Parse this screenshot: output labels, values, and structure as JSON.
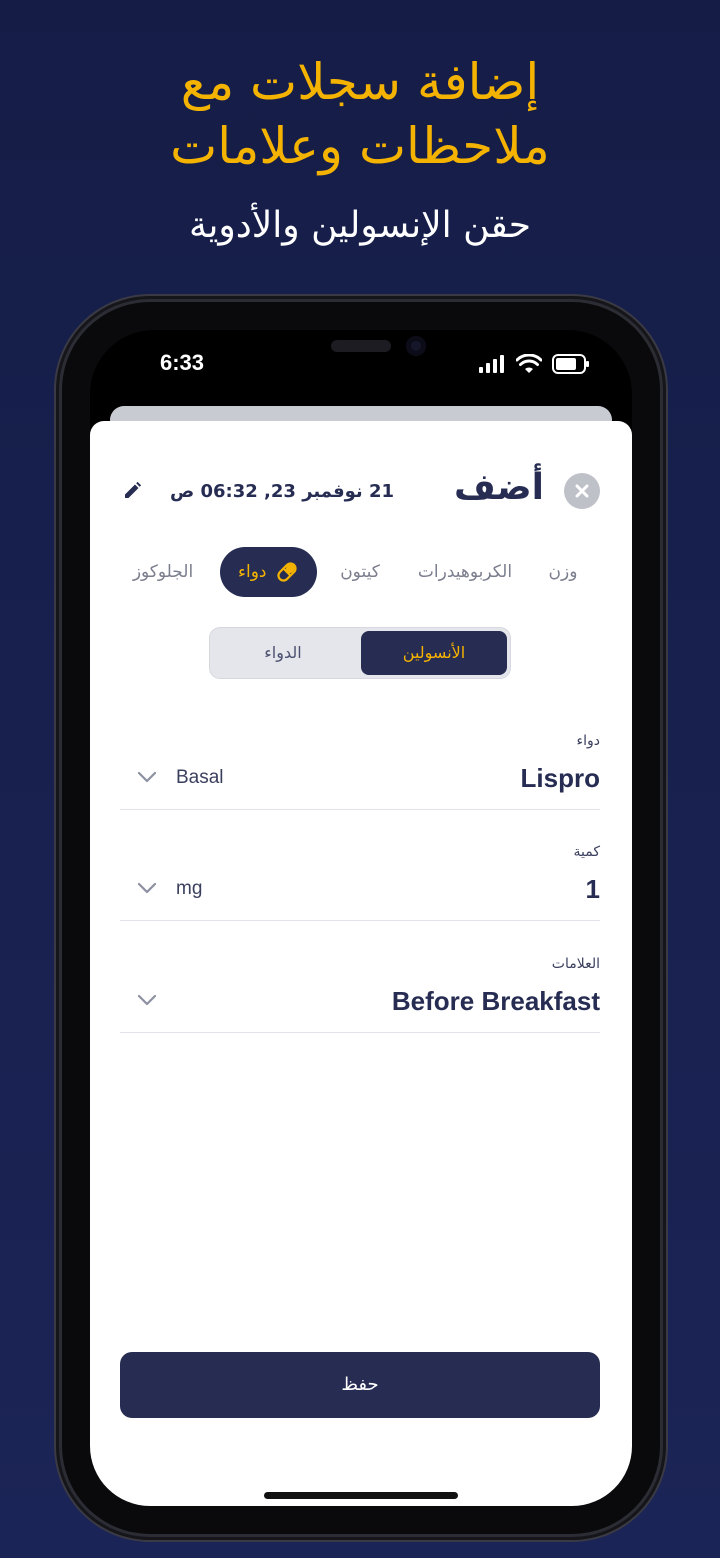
{
  "promo": {
    "headline_line1": "إضافة سجلات مع",
    "headline_line2": "ملاحظات وعلامات",
    "subheadline": "حقن الإنسولين والأدوية"
  },
  "status_bar": {
    "time": "6:33"
  },
  "sheet": {
    "title": "أضف",
    "datetime": "21 نوفمبر 23, 06:32 ص"
  },
  "tabs": [
    {
      "label": "وزن",
      "icon": "",
      "active": false
    },
    {
      "label": "الكربوهيدرات",
      "icon": "",
      "active": false
    },
    {
      "label": "كيتون",
      "icon": "",
      "active": false
    },
    {
      "label": "دواء",
      "icon": "pill-icon",
      "active": true
    },
    {
      "label": "الجلوكوز",
      "icon": "",
      "active": false
    }
  ],
  "segment": {
    "insulin_label": "الأنسولين",
    "medication_label": "الدواء",
    "selected": "insulin"
  },
  "fields": {
    "medication": {
      "label": "دواء",
      "value": "Lispro",
      "unit": "Basal"
    },
    "quantity": {
      "label": "كمية",
      "value": "1",
      "unit": "mg"
    },
    "tags": {
      "label": "العلامات",
      "value": "Before Breakfast"
    }
  },
  "save_button": {
    "label": "حفظ"
  },
  "colors": {
    "background": "#151d47",
    "accent": "#f5b301",
    "primary": "#262c52"
  }
}
